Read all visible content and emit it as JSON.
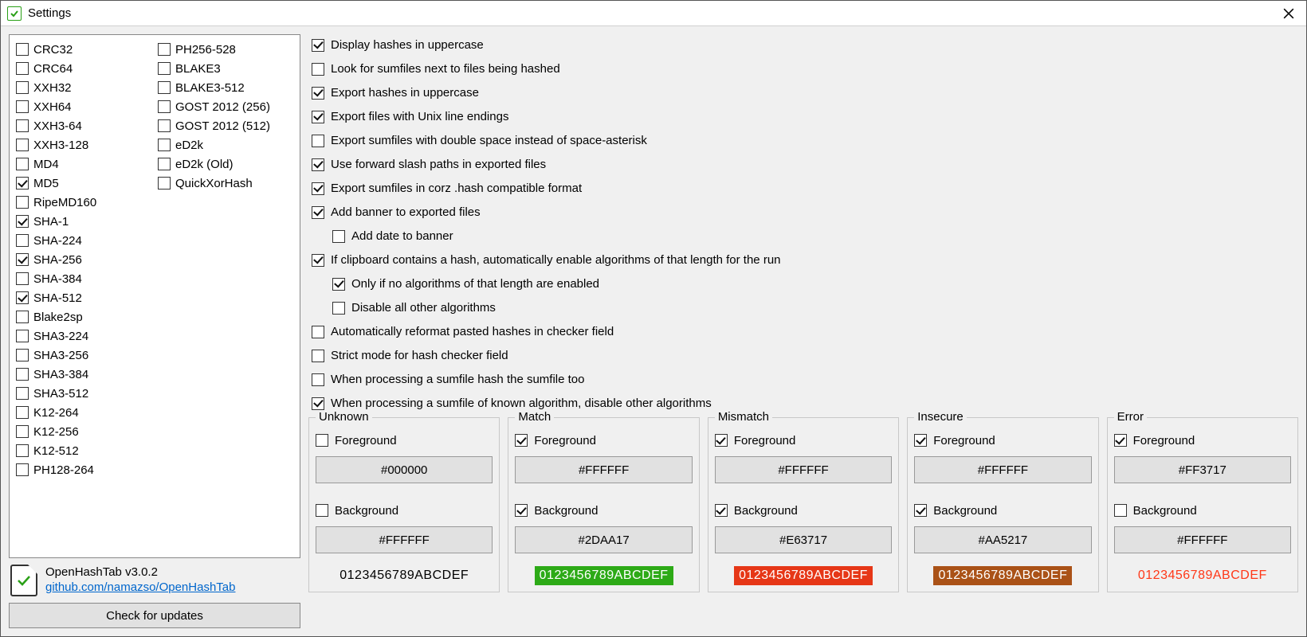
{
  "window": {
    "title": "Settings"
  },
  "algorithms": {
    "col1": [
      {
        "name": "CRC32",
        "checked": false
      },
      {
        "name": "CRC64",
        "checked": false
      },
      {
        "name": "XXH32",
        "checked": false
      },
      {
        "name": "XXH64",
        "checked": false
      },
      {
        "name": "XXH3-64",
        "checked": false
      },
      {
        "name": "XXH3-128",
        "checked": false
      },
      {
        "name": "MD4",
        "checked": false
      },
      {
        "name": "MD5",
        "checked": true
      },
      {
        "name": "RipeMD160",
        "checked": false
      },
      {
        "name": "SHA-1",
        "checked": true
      },
      {
        "name": "SHA-224",
        "checked": false
      },
      {
        "name": "SHA-256",
        "checked": true
      },
      {
        "name": "SHA-384",
        "checked": false
      },
      {
        "name": "SHA-512",
        "checked": true
      },
      {
        "name": "Blake2sp",
        "checked": false
      },
      {
        "name": "SHA3-224",
        "checked": false
      },
      {
        "name": "SHA3-256",
        "checked": false
      },
      {
        "name": "SHA3-384",
        "checked": false
      },
      {
        "name": "SHA3-512",
        "checked": false
      },
      {
        "name": "K12-264",
        "checked": false
      },
      {
        "name": "K12-256",
        "checked": false
      },
      {
        "name": "K12-512",
        "checked": false
      },
      {
        "name": "PH128-264",
        "checked": false
      }
    ],
    "col2": [
      {
        "name": "PH256-528",
        "checked": false
      },
      {
        "name": "BLAKE3",
        "checked": false
      },
      {
        "name": "BLAKE3-512",
        "checked": false
      },
      {
        "name": "GOST 2012 (256)",
        "checked": false
      },
      {
        "name": "GOST 2012 (512)",
        "checked": false
      },
      {
        "name": "eD2k",
        "checked": false
      },
      {
        "name": "eD2k (Old)",
        "checked": false
      },
      {
        "name": "QuickXorHash",
        "checked": false
      }
    ]
  },
  "about": {
    "product": "OpenHashTab v3.0.2",
    "link_text": "github.com/namazso/OpenHashTab"
  },
  "buttons": {
    "check_updates": "Check for updates"
  },
  "options": [
    {
      "label": "Display hashes in uppercase",
      "checked": true,
      "indent": 0
    },
    {
      "label": "Look for sumfiles next to files being hashed",
      "checked": false,
      "indent": 0
    },
    {
      "label": "Export hashes in uppercase",
      "checked": true,
      "indent": 0
    },
    {
      "label": "Export files with Unix line endings",
      "checked": true,
      "indent": 0
    },
    {
      "label": "Export sumfiles with double space instead of space-asterisk",
      "checked": false,
      "indent": 0
    },
    {
      "label": "Use forward slash paths in exported files",
      "checked": true,
      "indent": 0
    },
    {
      "label": "Export sumfiles in corz .hash compatible format",
      "checked": true,
      "indent": 0
    },
    {
      "label": "Add banner to exported files",
      "checked": true,
      "indent": 0
    },
    {
      "label": "Add date to banner",
      "checked": false,
      "indent": 1
    },
    {
      "label": "If clipboard contains a hash, automatically enable algorithms of that length for the run",
      "checked": true,
      "indent": 0
    },
    {
      "label": "Only if no algorithms of that length are enabled",
      "checked": true,
      "indent": 1
    },
    {
      "label": "Disable all other algorithms",
      "checked": false,
      "indent": 1
    },
    {
      "label": "Automatically reformat pasted hashes in checker field",
      "checked": false,
      "indent": 0
    },
    {
      "label": "Strict mode for hash checker field",
      "checked": false,
      "indent": 0
    },
    {
      "label": "When processing a sumfile hash the sumfile too",
      "checked": false,
      "indent": 0
    },
    {
      "label": "When processing a sumfile of known algorithm, disable other algorithms",
      "checked": true,
      "indent": 0
    }
  ],
  "color_labels": {
    "foreground": "Foreground",
    "background": "Background"
  },
  "sample_text": "0123456789ABCDEF",
  "color_groups": [
    {
      "title": "Unknown",
      "fg_checked": false,
      "fg": "#000000",
      "bg_checked": false,
      "bg": "#FFFFFF",
      "sample_fg": "#000000",
      "sample_bg": "transparent"
    },
    {
      "title": "Match",
      "fg_checked": true,
      "fg": "#FFFFFF",
      "bg_checked": true,
      "bg": "#2DAA17",
      "sample_fg": "#FFFFFF",
      "sample_bg": "#2DAA17"
    },
    {
      "title": "Mismatch",
      "fg_checked": true,
      "fg": "#FFFFFF",
      "bg_checked": true,
      "bg": "#E63717",
      "sample_fg": "#FFFFFF",
      "sample_bg": "#E63717"
    },
    {
      "title": "Insecure",
      "fg_checked": true,
      "fg": "#FFFFFF",
      "bg_checked": true,
      "bg": "#AA5217",
      "sample_fg": "#FFFFFF",
      "sample_bg": "#AA5217"
    },
    {
      "title": "Error",
      "fg_checked": true,
      "fg": "#FF3717",
      "bg_checked": false,
      "bg": "#FFFFFF",
      "sample_fg": "#FF3717",
      "sample_bg": "transparent"
    }
  ]
}
